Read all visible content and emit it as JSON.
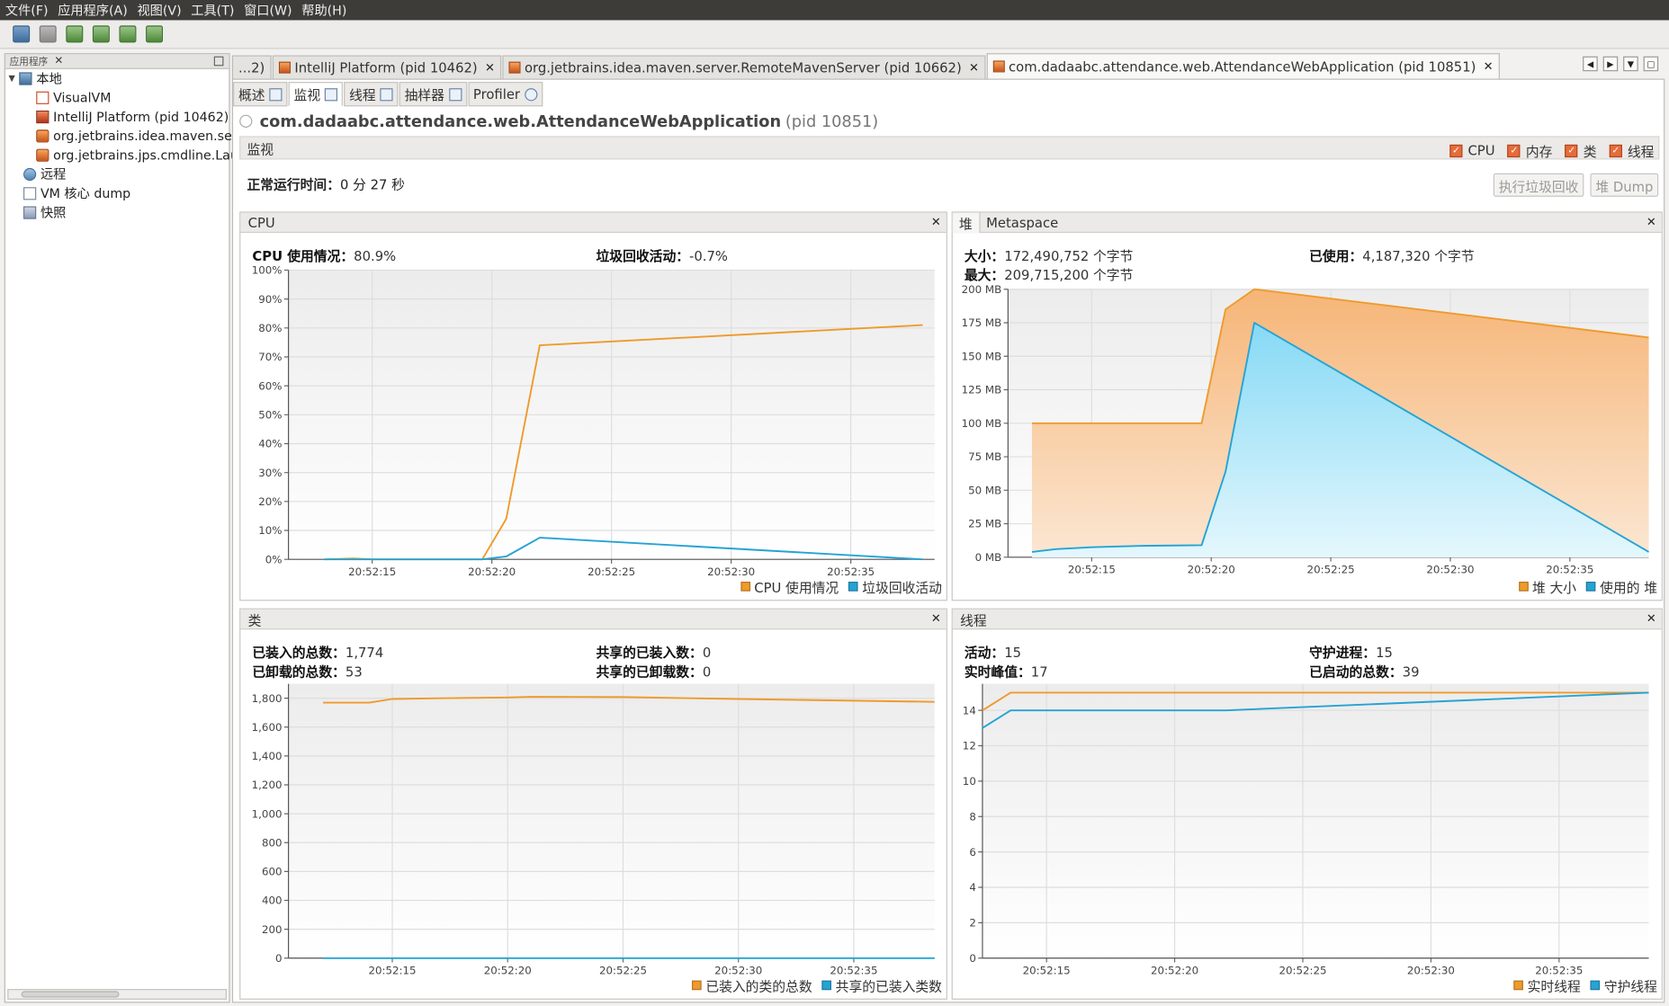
{
  "menu": [
    "文件(F)",
    "应用程序(A)",
    "视图(V)",
    "工具(T)",
    "窗口(W)",
    "帮助(H)"
  ],
  "sidebar": {
    "tab_label": "应用程序",
    "items": [
      {
        "label": "本地",
        "icon": "computer-icon"
      },
      {
        "label": "VisualVM",
        "icon": "visualvm-icon"
      },
      {
        "label": "IntelliJ Platform (pid 10462)",
        "icon": "intellij-icon"
      },
      {
        "label": "org.jetbrains.idea.maven.ser",
        "icon": "java-icon"
      },
      {
        "label": "org.jetbrains.jps.cmdline.Lau",
        "icon": "java-icon"
      },
      {
        "label": "远程",
        "icon": "network-icon"
      },
      {
        "label": "VM 核心 dump",
        "icon": "dump-icon"
      },
      {
        "label": "快照",
        "icon": "snapshot-icon"
      }
    ]
  },
  "doc_tabs": [
    {
      "label": "...2)"
    },
    {
      "label": "IntelliJ Platform (pid 10462)"
    },
    {
      "label": "org.jetbrains.idea.maven.server.RemoteMavenServer (pid 10662)"
    },
    {
      "label": "com.dadaabc.attendance.web.AttendanceWebApplication (pid 10851)"
    }
  ],
  "sub_tabs": [
    "概述",
    "监视",
    "线程",
    "抽样器",
    "Profiler"
  ],
  "app": {
    "name": "com.dadaabc.attendance.web.AttendanceWebApplication",
    "pid": "(pid 10851)"
  },
  "monitor": {
    "title": "监视",
    "checks": [
      "CPU",
      "内存",
      "类",
      "线程"
    ],
    "uptime_label": "正常运行时间：",
    "uptime_value": "0 分 27 秒",
    "gc_button": "执行垃圾回收",
    "heapdump_button": "堆 Dump"
  },
  "cpu_panel": {
    "title": "CPU",
    "cpu_usage_label": "CPU 使用情况：",
    "cpu_usage_value": "80.9%",
    "gc_label": "垃圾回收活动：",
    "gc_value": "-0.7%"
  },
  "heap_panel": {
    "tabs": [
      "堆",
      "Metaspace"
    ],
    "size_label": "大小：",
    "size_value": "172,490,752 个字节",
    "max_label": "最大：",
    "max_value": "209,715,200 个字节",
    "used_label": "已使用：",
    "used_value": "4,187,320 个字节"
  },
  "class_panel": {
    "title": "类",
    "loaded_label": "已装入的总数：",
    "loaded_value": "1,774",
    "unloaded_label": "已卸载的总数：",
    "unloaded_value": "53",
    "shared_loaded_label": "共享的已装入数：",
    "shared_loaded_value": "0",
    "shared_unloaded_label": "共享的已卸载数：",
    "shared_unloaded_value": "0"
  },
  "thread_panel": {
    "title": "线程",
    "live_label": "活动：",
    "live_value": "15",
    "peak_label": "实时峰值：",
    "peak_value": "17",
    "daemon_label": "守护进程：",
    "daemon_value": "15",
    "started_label": "已启动的总数：",
    "started_value": "39"
  },
  "colors": {
    "orange": "#ef9a2c",
    "blue": "#25a3d4",
    "orange_fill": "#f7c99a",
    "blue_fill": "#a5e3f7"
  },
  "chart_data": [
    {
      "type": "line",
      "id": "cpu",
      "x": [
        "20:52:13",
        "20:52:14",
        "20:52:15",
        "20:52:19.5",
        "20:52:20.5",
        "20:52:22",
        "20:52:38"
      ],
      "x_tick_labels": [
        "20:52:15",
        "20:52:20",
        "20:52:25",
        "20:52:30",
        "20:52:35"
      ],
      "y_tick_labels": [
        "0%",
        "10%",
        "20%",
        "30%",
        "40%",
        "50%",
        "60%",
        "70%",
        "80%",
        "90%",
        "100%"
      ],
      "ylim": [
        0,
        100
      ],
      "series": [
        {
          "name": "CPU 使用情况",
          "color": "#ef9a2c",
          "x": [
            13,
            14.2,
            15,
            19.6,
            20.6,
            22,
            38
          ],
          "values": [
            0,
            0.3,
            0,
            0,
            14,
            74,
            81
          ]
        },
        {
          "name": "垃圾回收活动",
          "color": "#25a3d4",
          "x": [
            13,
            19.6,
            20.6,
            22,
            38
          ],
          "values": [
            0,
            0,
            1,
            7.5,
            0
          ]
        }
      ]
    },
    {
      "type": "area",
      "id": "heap",
      "x_tick_labels": [
        "20:52:15",
        "20:52:20",
        "20:52:25",
        "20:52:30",
        "20:52:35"
      ],
      "y_tick_labels": [
        "0 MB",
        "25 MB",
        "50 MB",
        "75 MB",
        "100 MB",
        "125 MB",
        "150 MB",
        "175 MB",
        "200 MB"
      ],
      "ylim": [
        0,
        200
      ],
      "series": [
        {
          "name": "堆 大小",
          "color": "#ef9a2c",
          "x": [
            12.5,
            19.6,
            20.6,
            21.8,
            38.3
          ],
          "values": [
            100,
            100,
            185,
            200,
            164
          ]
        },
        {
          "name": "使用的 堆",
          "color": "#25a3d4",
          "x": [
            12.5,
            13.5,
            15,
            17,
            19.6,
            20.6,
            21.8,
            38.3
          ],
          "values": [
            4,
            6,
            7.5,
            8.5,
            9,
            64,
            175,
            4
          ]
        }
      ]
    },
    {
      "type": "line",
      "id": "classes",
      "x_tick_labels": [
        "20:52:15",
        "20:52:20",
        "20:52:25",
        "20:52:30",
        "20:52:35"
      ],
      "y_tick_labels": [
        "0",
        "200",
        "400",
        "600",
        "800",
        "1,000",
        "1,200",
        "1,400",
        "1,600",
        "1,800"
      ],
      "ylim": [
        0,
        1900
      ],
      "series": [
        {
          "name": "已装入的类的总数",
          "color": "#ef9a2c",
          "x": [
            12,
            13,
            14,
            15,
            17,
            20,
            21,
            25,
            30,
            38.5
          ],
          "values": [
            1770,
            1770,
            1770,
            1795,
            1800,
            1805,
            1810,
            1808,
            1795,
            1775
          ]
        },
        {
          "name": "共享的已装入类数",
          "color": "#25a3d4",
          "x": [
            12,
            38.5
          ],
          "values": [
            0,
            0
          ]
        }
      ]
    },
    {
      "type": "line",
      "id": "threads",
      "x_tick_labels": [
        "20:52:15",
        "20:52:20",
        "20:52:25",
        "20:52:30",
        "20:52:35"
      ],
      "y_tick_labels": [
        "0",
        "2",
        "4",
        "6",
        "8",
        "10",
        "12",
        "14"
      ],
      "ylim": [
        0,
        15.5
      ],
      "series": [
        {
          "name": "实时线程",
          "color": "#ef9a2c",
          "x": [
            12.5,
            13.6,
            38.5
          ],
          "values": [
            14,
            15,
            15
          ]
        },
        {
          "name": "守护线程",
          "color": "#25a3d4",
          "x": [
            12.5,
            13.6,
            22,
            38.5
          ],
          "values": [
            13,
            14,
            14,
            15
          ]
        }
      ]
    }
  ]
}
